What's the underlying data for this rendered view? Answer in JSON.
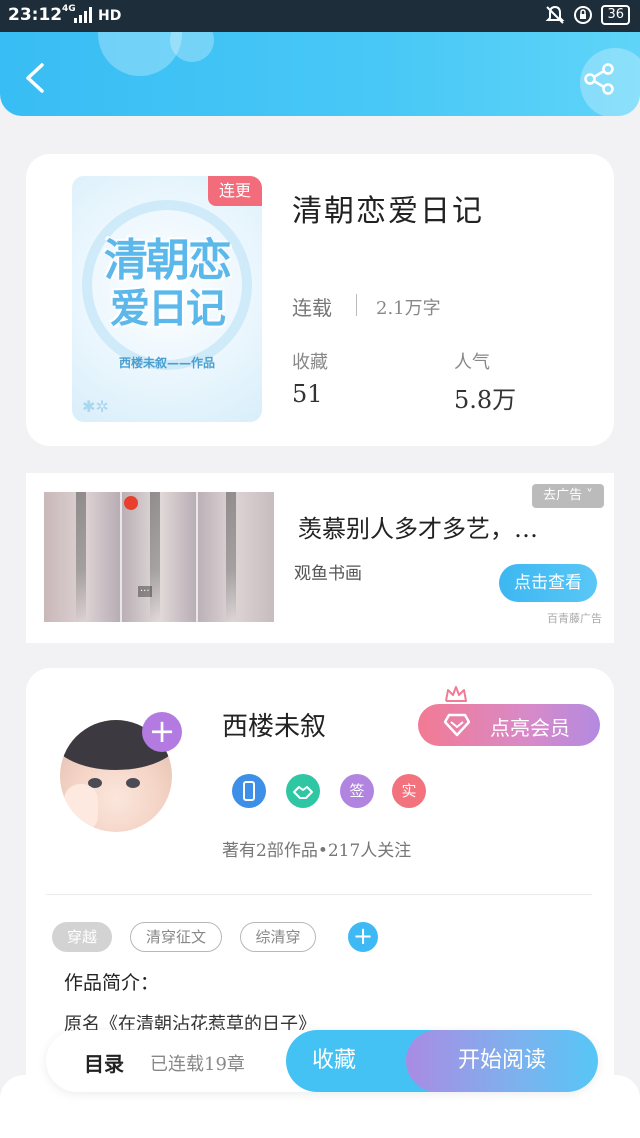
{
  "status_bar": {
    "time": "23:12",
    "network": "4G",
    "hd": "HD",
    "battery": "36"
  },
  "header": {
    "background_color": "#38bdf4"
  },
  "book": {
    "tag": "连更",
    "title": "清朝恋爱日记",
    "status": "连载",
    "word_count": "2.1万字",
    "collect_label": "收藏",
    "collect_value": "51",
    "popularity_label": "人气",
    "popularity_value": "5.8万",
    "cover": {
      "title_line1": "清朝恋",
      "title_line2": "爱日记",
      "author_line": "西楼未叙——作品"
    }
  },
  "ad": {
    "close_label": "去广告 ˅",
    "title": "羡慕别人多才多艺，…",
    "brand": "观鱼书画",
    "button_label": "点击查看",
    "source": "百青藤广告"
  },
  "author": {
    "name": "西楼未叙",
    "vip_button_label": "点亮会员",
    "badges": [
      {
        "label": "",
        "color": "#3d8fe8"
      },
      {
        "label": "",
        "color": "#2fc7a3"
      },
      {
        "label": "签",
        "color": "#b184e0"
      },
      {
        "label": "实",
        "color": "#f2727e"
      }
    ],
    "meta": "著有2部作品•217人关注",
    "tags": [
      "穿越",
      "清穿征文",
      "综清穿"
    ],
    "intro_title": "作品简介：",
    "intro_text": "原名《在清朝沾花惹草的日子》"
  },
  "bottom_bar": {
    "toc_label": "目录",
    "toc_count": "已连载19章",
    "favorite_label": "收藏",
    "read_label": "开始阅读"
  }
}
